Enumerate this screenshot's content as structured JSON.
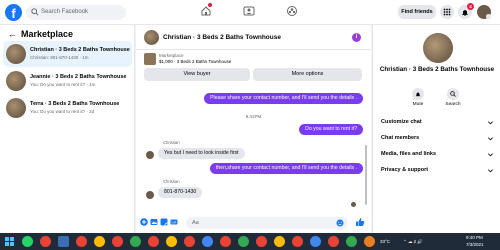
{
  "topbar": {
    "logo": "f",
    "search_placeholder": "Search Facebook",
    "find_friends": "Find friends",
    "notification_count": "4"
  },
  "sidebar": {
    "title": "Marketplace",
    "conversations": [
      {
        "name": "Christian · 3 Beds 2 Baths Townhouse",
        "preview": "Christian: 801-870-1430 · 1m",
        "active": true
      },
      {
        "name": "Jeannie · 3 Beds 2 Baths Townhouse",
        "preview": "You: Do you want to rent it? · 1m",
        "active": false
      },
      {
        "name": "Terra · 3 Beds 2 Baths Townhouse",
        "preview": "You: Do you want to rent it? · 2d",
        "active": false
      }
    ]
  },
  "chat": {
    "title": "Christian · 3 Beds 2 Baths Townhouse",
    "info_icon": "i",
    "listing": {
      "label": "Marketplace",
      "detail": "$1,000 · 3 Beds 2 Baths Townhouse"
    },
    "buttons": {
      "view_buyer": "View buyer",
      "more_options": "More options"
    },
    "messages": [
      {
        "from": "me",
        "text": "Please share your contact number, and I'll send you the details ."
      },
      {
        "type": "time",
        "text": "9:41PM"
      },
      {
        "from": "me",
        "text": "Do you want to rent it?"
      },
      {
        "from": "them",
        "sender": "Christian",
        "text": "Yes  but I need to look inside first"
      },
      {
        "from": "me",
        "text": "then,share your contact number, and I'll send you the details ."
      },
      {
        "from": "them",
        "sender": "Christian",
        "text": "801-870-1430"
      }
    ],
    "composer_placeholder": "Aa"
  },
  "right_panel": {
    "name": "Christian · 3 Beds 2 Baths Townhouse",
    "actions": {
      "mute": "Mute",
      "search": "Search"
    },
    "sections": [
      "Customize chat",
      "Chat members",
      "Media, files and links",
      "Privacy & support"
    ]
  },
  "taskbar": {
    "temperature": "33°C",
    "time": "9:40 PM",
    "date": "7/3/2021"
  },
  "colors": {
    "brand": "#1877f2",
    "outgoing_bubble": "#7a3cf0",
    "incoming_bubble": "#e4e6eb",
    "taskbar": "#202b3a"
  }
}
